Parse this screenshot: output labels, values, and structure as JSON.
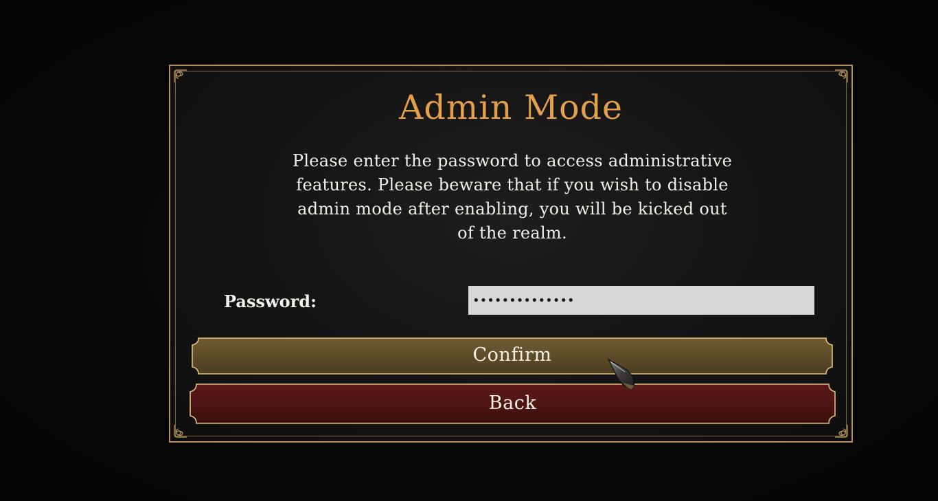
{
  "dialog": {
    "title": "Admin Mode",
    "description": "Please enter the password to access administrative features. Please beware that if you wish to disable admin mode after enabling, you will be kicked out of the realm.",
    "password_label": "Password:",
    "password_value": "••••••••••••••",
    "confirm_label": "Confirm",
    "back_label": "Back"
  },
  "colors": {
    "title": "#e3a04d",
    "border": "#b08f58",
    "confirm_button": "#5e4d2a",
    "back_button": "#4e1414",
    "input_bg": "#d8d8d8"
  },
  "icons": {
    "corner": "ornament-corner-icon",
    "cursor": "gauntlet-cursor-icon"
  }
}
